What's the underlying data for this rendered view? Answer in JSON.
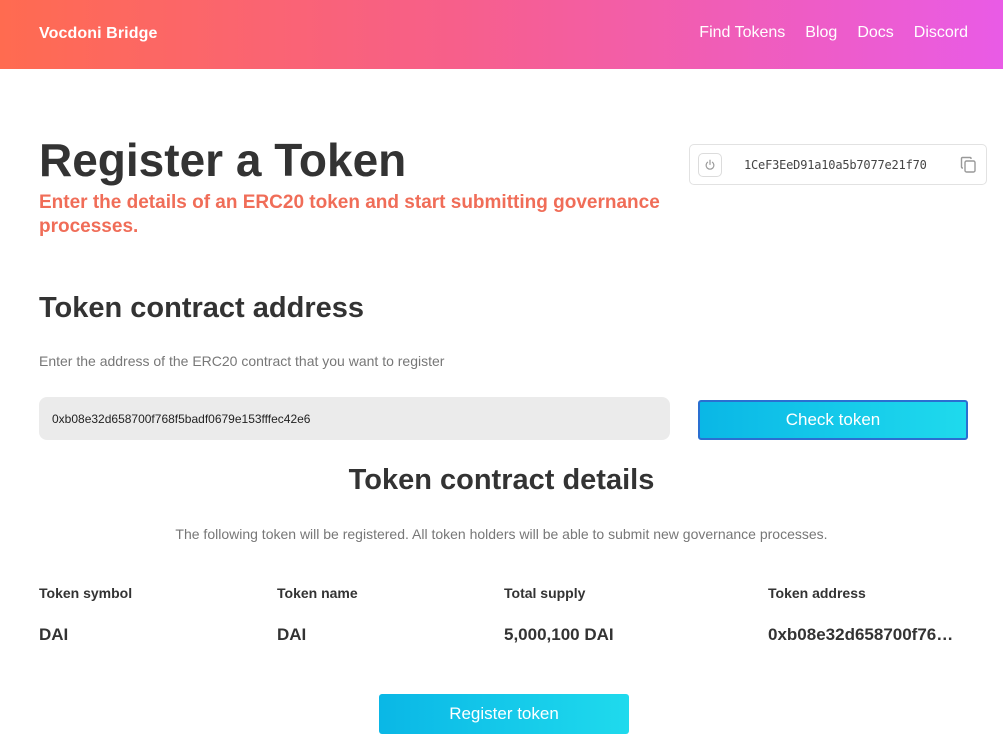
{
  "header": {
    "brand": "Vocdoni Bridge",
    "nav": [
      "Find Tokens",
      "Blog",
      "Docs",
      "Discord"
    ]
  },
  "page": {
    "title": "Register a Token",
    "subtitle": "Enter the details of an ERC20 token and start submitting governance processes."
  },
  "wallet": {
    "address": "1CeF3EeD91a10a5b7077e21f70"
  },
  "contract": {
    "section_title": "Token contract address",
    "description": "Enter the address of the ERC20 contract that you want to register",
    "input_value": "0xb08e32d658700f768f5badf0679e153fffec42e6",
    "check_label": "Check token"
  },
  "details": {
    "title": "Token contract details",
    "description": "The following token will be registered. All token holders will be able to submit new governance processes.",
    "symbol_label": "Token symbol",
    "symbol": "DAI",
    "name_label": "Token name",
    "name": "DAI",
    "supply_label": "Total supply",
    "supply": "5,000,100 DAI",
    "address_label": "Token address",
    "address": "0xb08e32d658700f76…"
  },
  "register_label": "Register token",
  "colors": {
    "accent_text": "#f06d58",
    "button_gradient_start": "#0ab7e6",
    "button_gradient_end": "#1fdaed",
    "header_gradient_start": "#ff6b50",
    "header_gradient_end": "#e95be6"
  },
  "icons": {
    "wallet_power": "power-icon",
    "wallet_copy": "copy-icon"
  }
}
